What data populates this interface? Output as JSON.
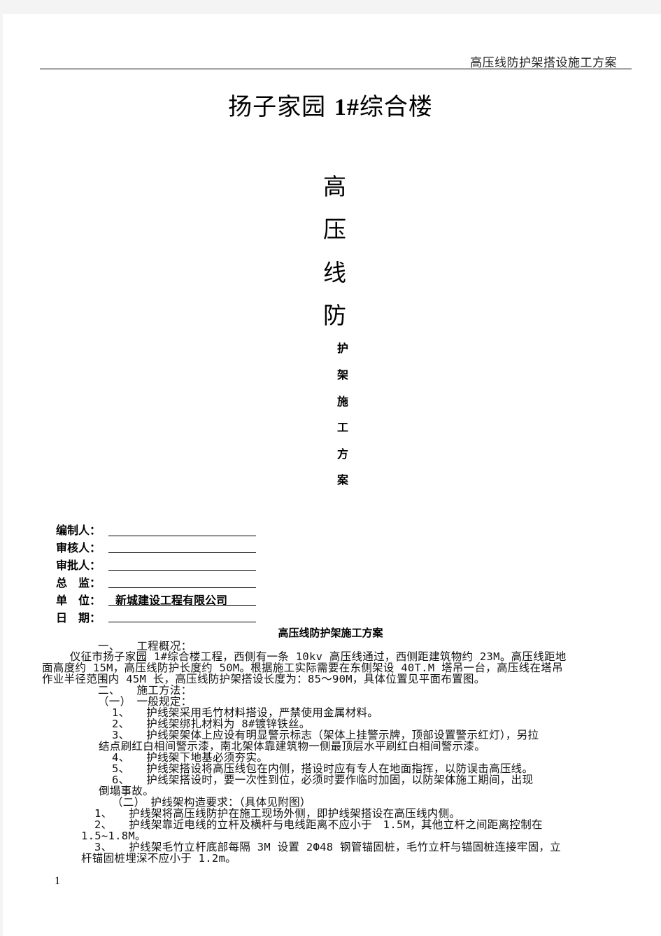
{
  "header": {
    "running_title": "高压线防护架搭设施工方案"
  },
  "cover": {
    "project_title_part1": "扬子家园 ",
    "project_title_num": "1#",
    "project_title_part2": "综合楼",
    "vertical_title_large": [
      "高",
      "压",
      "线",
      "防"
    ],
    "vertical_title_small": [
      "护",
      "架",
      "施",
      "工",
      "方",
      "案"
    ]
  },
  "signatures": [
    {
      "label": "编制人：",
      "value": ""
    },
    {
      "label": "审核人：",
      "value": ""
    },
    {
      "label": "审批人：",
      "value": ""
    },
    {
      "label": "总　监：",
      "value": ""
    },
    {
      "label": "单　位：",
      "value": "新城建设工程有限公司"
    },
    {
      "label": "日　期：",
      "value": ""
    }
  ],
  "section": {
    "title": "高压线防护架施工方案",
    "lines": [
      {
        "text": "一、　　工程概况：",
        "indent": "h1"
      },
      {
        "text": "　仪征市扬子家园 1#综合楼工程，西侧有一条 10kv 高压线通过，西侧距建筑物约 23M。高压线距地",
        "indent": "p"
      },
      {
        "text": "面高度约 15M，高压线防护长度约 50M。根据施工实际需要在东侧架设 40T.M 塔吊一台，高压线在塔吊",
        "indent": "p0"
      },
      {
        "text": "作业半径范围内 45M 长，高压线防护架搭设长度为：85～90M，具体位置见平面布置图。",
        "indent": "p0"
      },
      {
        "text": "二、　　施工方法：",
        "indent": "h1"
      },
      {
        "text": "（一）　一般规定：",
        "indent": "h2"
      },
      {
        "text": "1、　　护线架采用毛竹材料搭设，严禁使用金属材料。",
        "indent": "li"
      },
      {
        "text": "2、　　护线架绑扎材料为 8#镀锌铁丝。",
        "indent": "li"
      },
      {
        "text": "3、　　护线架架体上应设有明显警示标志（架体上挂警示牌，顶部设置警示红灯），另拉",
        "indent": "li"
      },
      {
        "text": "结点刷红白相间警示漆，南北架体靠建筑物一侧最顶层水平刷红白相间警示漆。",
        "indent": "cont"
      },
      {
        "text": "4、　　护线架下地基必须夯实。",
        "indent": "li"
      },
      {
        "text": "5、　　护线架搭设将高压线包在内侧，搭设时应有专人在地面指挥，以防误击高压线。",
        "indent": "li"
      },
      {
        "text": "6、　　护线架搭设时，要一次性到位，必须时要作临时加固，以防架体施工期间，出现",
        "indent": "li"
      },
      {
        "text": "倒塌事故。",
        "indent": "cont"
      },
      {
        "text": "（二）　护线架构造要求：（具体见附图）",
        "indent": "h2"
      },
      {
        "text": "1、　　护线架将高压线防护在施工现场外侧，即护线架搭设在高压线内侧。",
        "indent": "li2"
      },
      {
        "text": "2、　　护线架靠近电线的立杆及横杆与电线距离不应小于　1.5M，其他立杆之间距离控制在",
        "indent": "li2"
      },
      {
        "text": "1.5~1.8M。",
        "indent": "cont2"
      },
      {
        "text": "3、　　护线架毛竹立杆底部每隔 3M 设置 2Ф48 钢管锚固桩，毛竹立杆与锚固桩连接牢固，立",
        "indent": "li2"
      },
      {
        "text": "杆锚固桩埋深不应小于 1.2m。",
        "indent": "cont2"
      }
    ]
  },
  "footer": {
    "page_number": "1"
  }
}
